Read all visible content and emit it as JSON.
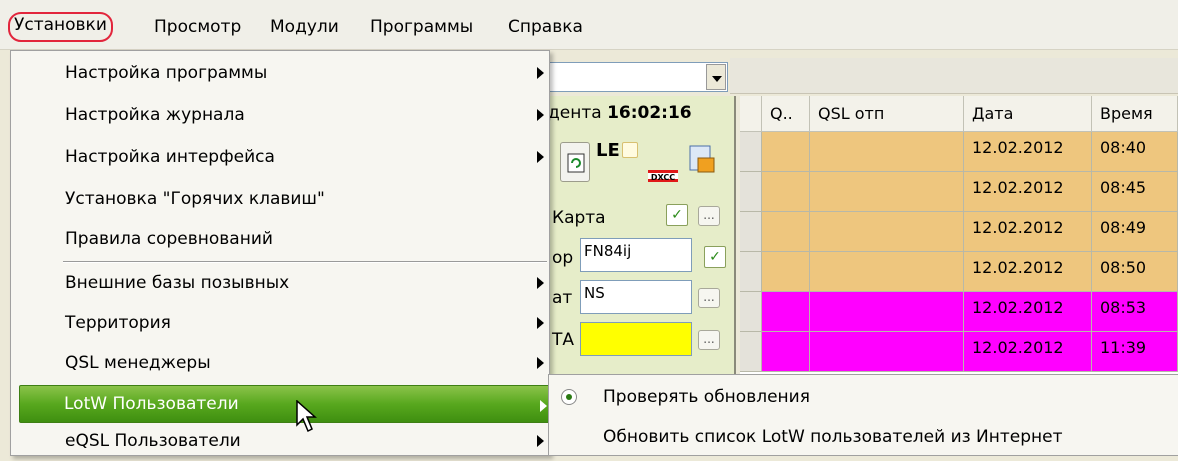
{
  "menubar": {
    "items": [
      "Установки",
      "Просмотр",
      "Модули",
      "Программы",
      "Справка"
    ]
  },
  "left_panel": {
    "clock_prefix": "дента",
    "clock_time": "16:02:16",
    "le_label": "LE",
    "dxcc_label": "DXCC",
    "map_label": "Карта",
    "locator_label": "ор",
    "locator_value": "FN84ij",
    "state_label": "ат",
    "state_value": "NS",
    "iota_label": "ТА",
    "dots": "..."
  },
  "grid": {
    "headers": [
      "Q..",
      "QSL отп",
      "Дата",
      "Время"
    ],
    "rows": [
      {
        "date": "12.02.2012",
        "time": "08:40",
        "color": "#eec67e"
      },
      {
        "date": "12.02.2012",
        "time": "08:45",
        "color": "#eec67e"
      },
      {
        "date": "12.02.2012",
        "time": "08:49",
        "color": "#eec67e"
      },
      {
        "date": "12.02.2012",
        "time": "08:50",
        "color": "#eec67e"
      },
      {
        "date": "12.02.2012",
        "time": "08:53",
        "color": "#ff00ff"
      },
      {
        "date": "12.02.2012",
        "time": "11:39",
        "color": "#ff00ff"
      }
    ]
  },
  "menu": {
    "items": [
      {
        "label": "Настройка программы",
        "submenu": true
      },
      {
        "label": "Настройка журнала",
        "submenu": true
      },
      {
        "label": "Настройка интерфейса",
        "submenu": true
      },
      {
        "label": "Установка \"Горячих клавиш\"",
        "submenu": false
      },
      {
        "label": "Правила соревнований",
        "submenu": false
      },
      {
        "label": "Внешние базы позывных",
        "submenu": true
      },
      {
        "label": "Территория",
        "submenu": true
      },
      {
        "label": "QSL менеджеры",
        "submenu": true
      },
      {
        "label": "LotW Пользователи",
        "submenu": true,
        "highlighted": true
      },
      {
        "label": "eQSL Пользователи",
        "submenu": true
      }
    ]
  },
  "submenu": {
    "items": [
      {
        "label": "Проверять обновления",
        "checked": true
      },
      {
        "label": "Обновить список LotW пользователей из Интернет",
        "checked": false
      }
    ]
  },
  "colors": {
    "highlight": "#58a81e",
    "row_orange": "#eec67e",
    "row_magenta": "#ff00ff",
    "menu_border_circle": "#e2253c"
  }
}
